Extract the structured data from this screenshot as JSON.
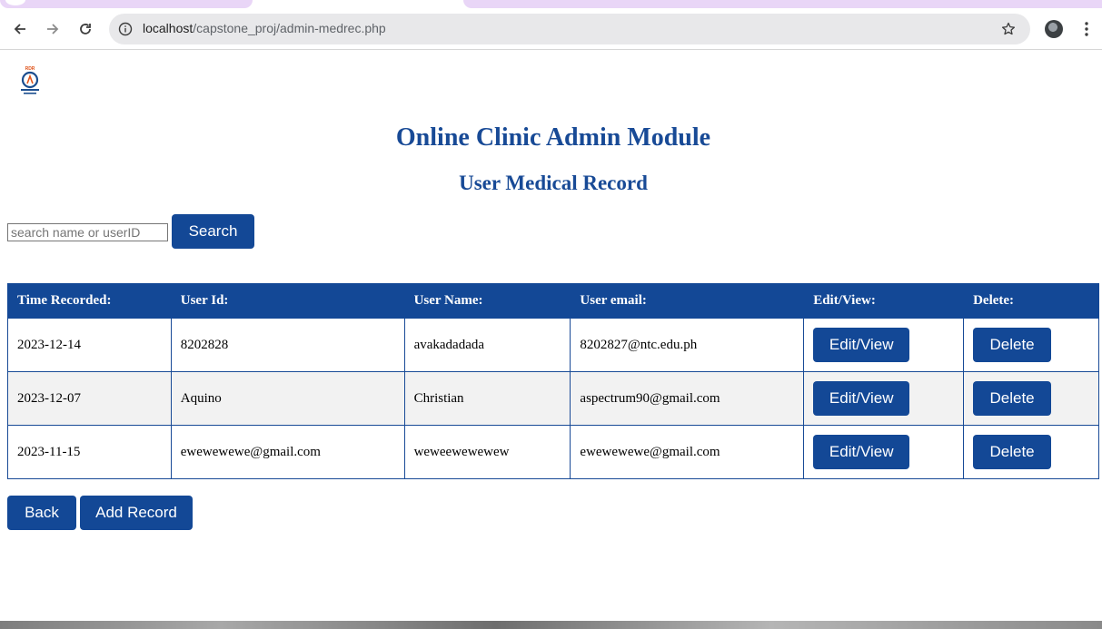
{
  "browser": {
    "url_host": "localhost",
    "url_path": "/capstone_proj/admin-medrec.php",
    "icons": {
      "back": "arrow-left-icon",
      "forward": "arrow-right-icon",
      "reload": "reload-icon",
      "info": "info-icon",
      "bookmark": "star-icon",
      "profile": "avatar",
      "menu": "kebab-menu-icon"
    }
  },
  "page": {
    "logo_text": "RDR Diagnostic Center",
    "title": "Online Clinic Admin Module",
    "subtitle": "User Medical Record",
    "search": {
      "placeholder": "search name or userID",
      "value": "",
      "button_label": "Search"
    },
    "table": {
      "headers": [
        "Time Recorded:",
        "User Id:",
        "User Name:",
        "User email:",
        "Edit/View:",
        "Delete:"
      ],
      "rows": [
        {
          "time": "2023-12-14",
          "user_id": "8202828",
          "user_name": "avakadadada",
          "email": "8202827@ntc.edu.ph",
          "edit_label": "Edit/View",
          "delete_label": "Delete"
        },
        {
          "time": "2023-12-07",
          "user_id": "Aquino",
          "user_name": "Christian",
          "email": "aspectrum90@gmail.com",
          "edit_label": "Edit/View",
          "delete_label": "Delete"
        },
        {
          "time": "2023-11-15",
          "user_id": "ewewewewe@gmail.com",
          "user_name": "weweewewewew",
          "email": "ewewewewe@gmail.com",
          "edit_label": "Edit/View",
          "delete_label": "Delete"
        }
      ]
    },
    "footer_buttons": {
      "back": "Back",
      "add_record": "Add Record"
    },
    "colors": {
      "primary": "#134896",
      "heading": "#184a96",
      "row_alt": "#f2f2f2"
    }
  }
}
